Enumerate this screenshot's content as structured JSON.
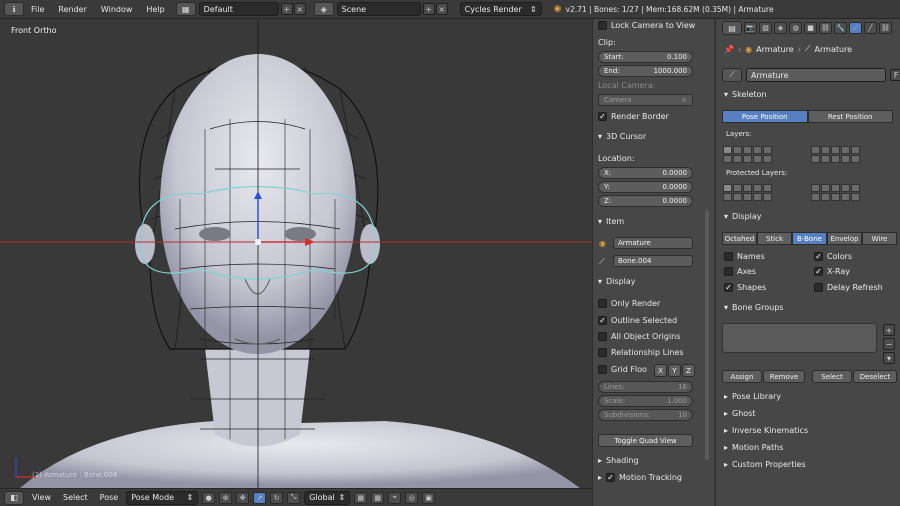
{
  "topbar": {
    "menus": [
      "File",
      "Render",
      "Window",
      "Help"
    ],
    "screen_layout": "Default",
    "scene": "Scene",
    "engine": "Cycles Render",
    "stats": "v2.71 | Bones: 1/27 | Mem:168.62M (0.35M) | Armature"
  },
  "viewport": {
    "view_label": "Front Ortho",
    "object_label": "(2) Armature : Bone.004"
  },
  "bottombar": {
    "view": "View",
    "select": "Select",
    "pose": "Pose",
    "mode": "Pose Mode",
    "orientation": "Global"
  },
  "npanel": {
    "lock_camera": "Lock Camera to View",
    "clip_title": "Clip:",
    "clip_start_label": "Start:",
    "clip_start": "0.100",
    "clip_end_label": "End:",
    "clip_end": "1000.000",
    "local_camera": "Local Camera:",
    "camera_field": "Camera",
    "render_border": "Render Border",
    "cursor_title": "3D Cursor",
    "location": "Location:",
    "x_label": "X:",
    "x": "0.0000",
    "y_label": "Y:",
    "y": "0.0000",
    "z_label": "Z:",
    "z": "0.0000",
    "item_title": "Item",
    "item_object": "Armature",
    "item_bone": "Bone.004",
    "display_title": "Display",
    "only_render": "Only Render",
    "outline_selected": "Outline Selected",
    "all_origins": "All Object Origins",
    "relationship_lines": "Relationship Lines",
    "grid_floor": "Grid Floo",
    "axis_x": "X",
    "axis_y": "Y",
    "axis_z": "Z",
    "lines_label": "Lines:",
    "lines": "16",
    "scale_label": "Scale:",
    "scale": "1.000",
    "subdiv_label": "Subdivisions:",
    "subdiv": "10",
    "toggle_quad": "Toggle Quad View",
    "shading": "Shading",
    "motion_tracking": "Motion Tracking"
  },
  "props": {
    "breadcrumb_armature1": "Armature",
    "breadcrumb_armature2": "Armature",
    "data_name": "Armature",
    "data_f": "F",
    "skeleton_title": "Skeleton",
    "pose_position": "Pose Position",
    "rest_position": "Rest Position",
    "layers_label": "Layers:",
    "protected_layers_label": "Protected Layers:",
    "display_title": "Display",
    "draw_types": [
      "Octahed",
      "Stick",
      "B-Bone",
      "Envelop",
      "Wire"
    ],
    "names": "Names",
    "axes": "Axes",
    "shapes": "Shapes",
    "colors": "Colors",
    "xray": "X-Ray",
    "delay_refresh": "Delay Refresh",
    "bone_groups_title": "Bone Groups",
    "assign": "Assign",
    "remove": "Remove",
    "select": "Select",
    "deselect": "Deselect",
    "pose_library": "Pose Library",
    "ghost": "Ghost",
    "inverse_kinematics": "Inverse Kinematics",
    "motion_paths": "Motion Paths",
    "custom_properties": "Custom Properties"
  },
  "colors": {
    "accent": "#5680c2",
    "panel_bg": "#474747",
    "viewport_bg": "#393939"
  }
}
